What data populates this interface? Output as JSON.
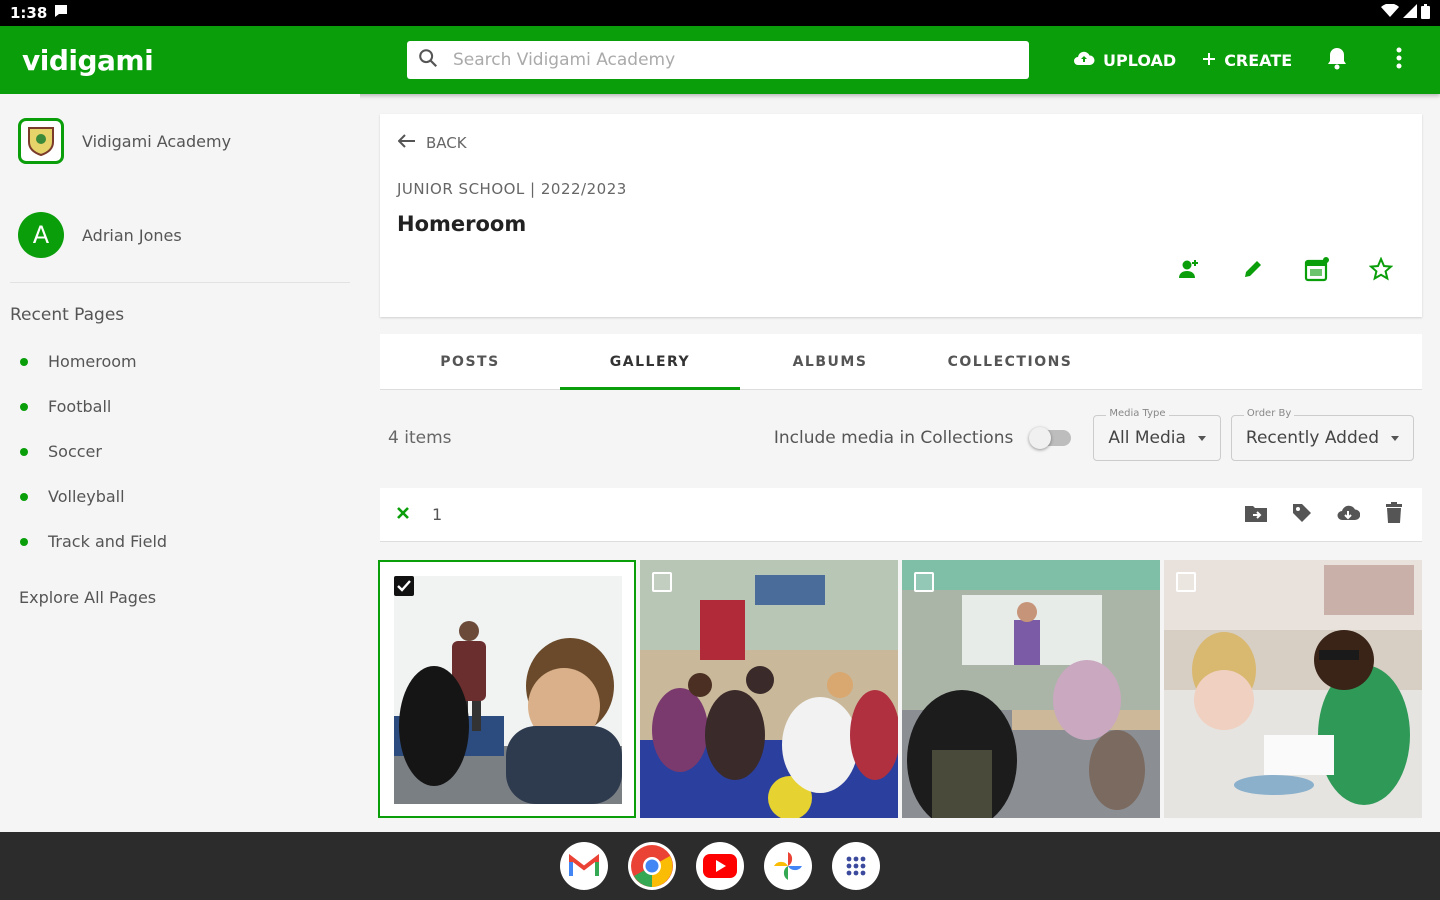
{
  "status_bar": {
    "time": "1:38"
  },
  "app": {
    "logo": "vidigami",
    "search_placeholder": "Search Vidigami Academy",
    "upload_label": "UPLOAD",
    "create_label": "CREATE"
  },
  "sidebar": {
    "org_name": "Vidigami Academy",
    "user_initial": "A",
    "user_name": "Adrian Jones",
    "recent_title": "Recent Pages",
    "recent_pages": [
      "Homeroom",
      "Football",
      "Soccer",
      "Volleyball",
      "Track and Field"
    ],
    "explore_label": "Explore All Pages"
  },
  "header": {
    "back_label": "BACK",
    "breadcrumb": "JUNIOR SCHOOL | 2022/2023",
    "title": "Homeroom"
  },
  "tabs": [
    {
      "label": "POSTS",
      "active": false
    },
    {
      "label": "GALLERY",
      "active": true
    },
    {
      "label": "ALBUMS",
      "active": false
    },
    {
      "label": "COLLECTIONS",
      "active": false
    }
  ],
  "filters": {
    "items_count": "4 items",
    "include_collections_label": "Include media in Collections",
    "include_collections_on": false,
    "media_type_label": "Media Type",
    "media_type_value": "All Media",
    "order_by_label": "Order By",
    "order_by_value": "Recently Added"
  },
  "selection": {
    "count": "1"
  },
  "gallery": [
    {
      "selected": true,
      "scene": "teacher-at-whiteboard"
    },
    {
      "selected": false,
      "scene": "students-on-rug"
    },
    {
      "selected": false,
      "scene": "classroom-desks"
    },
    {
      "selected": false,
      "scene": "student-writing"
    }
  ],
  "colors": {
    "brand_green": "#0a9e0a",
    "dock": "#2c2c2c"
  },
  "dock_apps": [
    "gmail-icon",
    "chrome-icon",
    "youtube-icon",
    "photos-icon",
    "app-launcher-icon"
  ]
}
